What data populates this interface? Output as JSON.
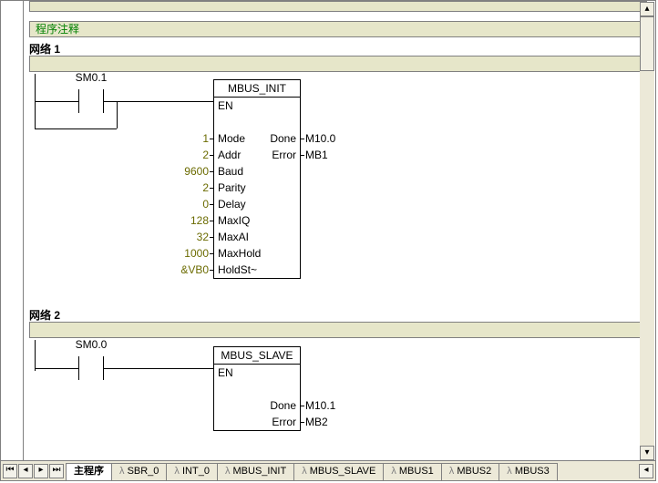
{
  "comment_label": "程序注释",
  "network1": {
    "label": "网络 1",
    "contact": "SM0.1",
    "block": {
      "title": "MBUS_INIT",
      "en": "EN",
      "inputs": [
        {
          "pin": "Mode",
          "val": "1"
        },
        {
          "pin": "Addr",
          "val": "2"
        },
        {
          "pin": "Baud",
          "val": "9600"
        },
        {
          "pin": "Parity",
          "val": "2"
        },
        {
          "pin": "Delay",
          "val": "0"
        },
        {
          "pin": "MaxIQ",
          "val": "128"
        },
        {
          "pin": "MaxAI",
          "val": "32"
        },
        {
          "pin": "MaxHold",
          "val": "1000"
        },
        {
          "pin": "HoldSt~",
          "val": "&VB0"
        }
      ],
      "outputs": [
        {
          "pin": "Done",
          "val": "M10.0"
        },
        {
          "pin": "Error",
          "val": "MB1"
        }
      ]
    }
  },
  "network2": {
    "label": "网络 2",
    "contact": "SM0.0",
    "block": {
      "title": "MBUS_SLAVE",
      "en": "EN",
      "outputs": [
        {
          "pin": "Done",
          "val": "M10.1"
        },
        {
          "pin": "Error",
          "val": "MB2"
        }
      ]
    }
  },
  "tabs": {
    "active": "主程序",
    "others": [
      "SBR_0",
      "INT_0",
      "MBUS_INIT",
      "MBUS_SLAVE",
      "MBUS1",
      "MBUS2",
      "MBUS3"
    ]
  }
}
